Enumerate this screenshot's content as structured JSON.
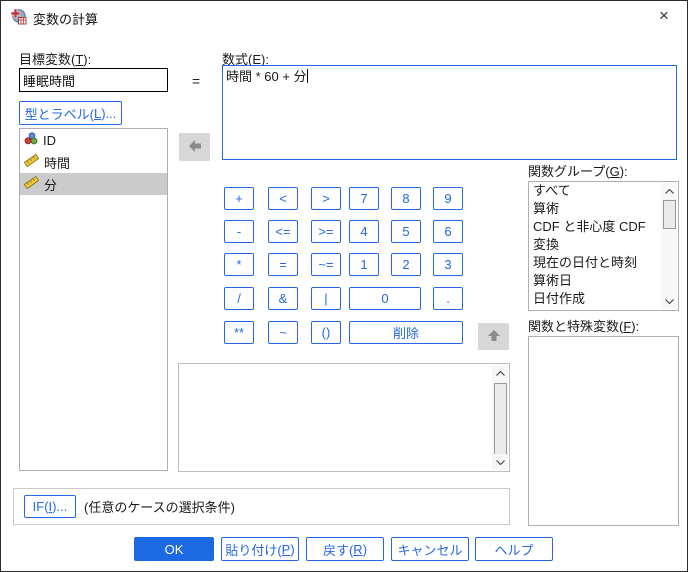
{
  "colors": {
    "accent_blue": "#2467e8",
    "ok_button_fill": "#1b69e3",
    "selected_row_gray": "#cbcbcb"
  },
  "window": {
    "title": "変数の計算",
    "close_glyph": "×"
  },
  "target": {
    "label": {
      "pre": "目標変数(",
      "key": "T",
      "post": "):"
    },
    "value": "睡眠時間",
    "equals": "="
  },
  "type_label_button": {
    "pre": "型とラベル(",
    "key": "L",
    "post": ")..."
  },
  "expression": {
    "label": {
      "pre": "数式(",
      "key": "E",
      "post": "):"
    },
    "value": "時間 * 60 + 分"
  },
  "variables": [
    {
      "name": "ID",
      "type": "nominal"
    },
    {
      "name": "時間",
      "type": "scale"
    },
    {
      "name": "分",
      "type": "scale",
      "selected": true
    }
  ],
  "keypad": {
    "plus": "+",
    "lt": "<",
    "gt": ">",
    "n7": "7",
    "n8": "8",
    "n9": "9",
    "minus": "-",
    "le": "<=",
    "ge": ">=",
    "n4": "4",
    "n5": "5",
    "n6": "6",
    "mul": "*",
    "eq": "=",
    "ne": "~=",
    "n1": "1",
    "n2": "2",
    "n3": "3",
    "div": "/",
    "and": "&",
    "or": "|",
    "n0": "0",
    "dot": ".",
    "pow": "**",
    "not": "~",
    "paren": "()",
    "del": "削除"
  },
  "function_group": {
    "label": {
      "pre": "関数グループ(",
      "key": "G",
      "post": "):"
    },
    "items": [
      "すべて",
      "算術",
      "CDF と非心度 CDF",
      "変換",
      "現在の日付と時刻",
      "算術日",
      "日付作成"
    ]
  },
  "functions_special": {
    "label": {
      "pre": "関数と特殊変数(",
      "key": "F",
      "post": "):"
    }
  },
  "if_row": {
    "button": {
      "pre": "IF(",
      "key": "I",
      "post": ")..."
    },
    "text": "(任意のケースの選択条件)"
  },
  "footer": {
    "ok": "OK",
    "paste": {
      "pre": "貼り付け(",
      "key": "P",
      "post": ")"
    },
    "reset": {
      "pre": "戻す(",
      "key": "R",
      "post": ")"
    },
    "cancel": "キャンセル",
    "help": "ヘルプ"
  }
}
